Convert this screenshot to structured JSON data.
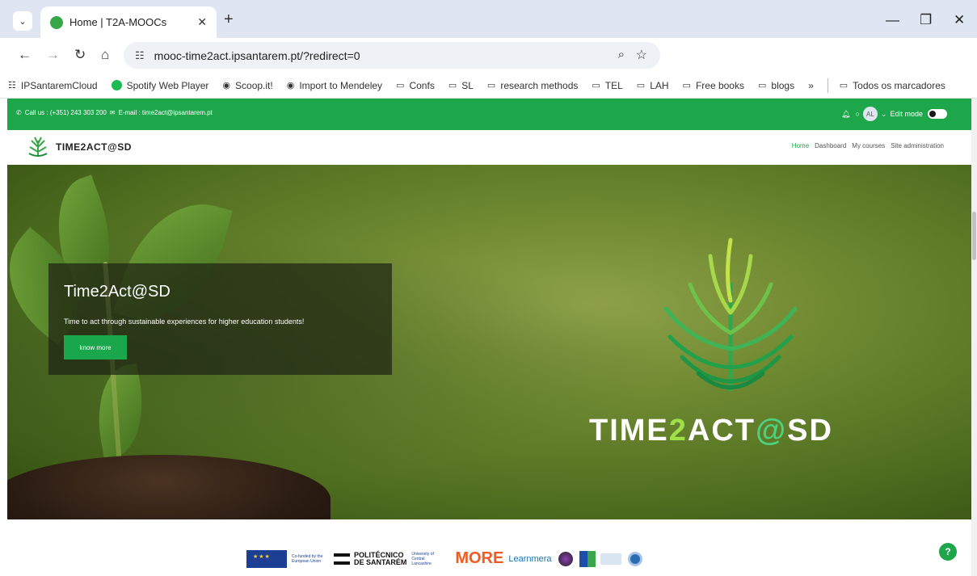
{
  "browser": {
    "tab": {
      "title": "Home | T2A-MOOCs"
    },
    "url": "mooc-time2act.ipsantarem.pt/?redirect=0",
    "bookmarks": [
      {
        "label": "IPSantaremCloud",
        "icon": "apps-icon"
      },
      {
        "label": "Spotify Web Player",
        "icon": "spotify-icon"
      },
      {
        "label": "Scoop.it!",
        "icon": "globe-icon"
      },
      {
        "label": "Import to Mendeley",
        "icon": "globe-icon"
      },
      {
        "label": "Confs",
        "icon": "folder-icon"
      },
      {
        "label": "SL",
        "icon": "folder-icon"
      },
      {
        "label": "research methods",
        "icon": "folder-icon"
      },
      {
        "label": "TEL",
        "icon": "folder-icon"
      },
      {
        "label": "LAH",
        "icon": "folder-icon"
      },
      {
        "label": "Free books",
        "icon": "folder-icon"
      },
      {
        "label": "blogs",
        "icon": "folder-icon"
      }
    ],
    "more_bookmarks": "»",
    "all_bookmarks": "Todos os marcadores"
  },
  "site": {
    "topbar": {
      "phone": "Call us : (+351) 243 303 200",
      "email": "E-mail : time2act@ipsantarem.pt",
      "avatar_initials": "AL",
      "edit_mode": "Edit mode"
    },
    "logo_text": "TIME2ACT@SD",
    "menu": [
      "Home",
      "Dashboard",
      "My courses",
      "Site administration"
    ],
    "hero": {
      "title": "Time2Act@SD",
      "subtitle": "Time to act through sustainable experiences for higher education students!",
      "button": "know more",
      "brand_parts": [
        "TIME",
        "2",
        "ACT",
        "@",
        "SD"
      ]
    },
    "partners": {
      "eu_text": "Co-funded by the European Union",
      "ips_line1": "POLITÉCNICO",
      "ips_line2": "DE SANTARÉM",
      "uclan": "University of Central Lancashire",
      "thomas_more": "MORE",
      "learnmera": "Learnmera"
    },
    "help_label": "?"
  },
  "colors": {
    "accent": "#1da64a",
    "browser_chrome": "#dfe6f1"
  }
}
